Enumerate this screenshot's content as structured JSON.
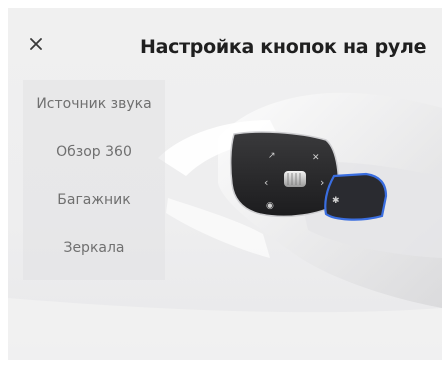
{
  "header": {
    "title": "Настройка кнопок на руле",
    "close_icon": "close-icon"
  },
  "menu": {
    "items": [
      {
        "label": "Источник звука"
      },
      {
        "label": "Обзор 360"
      },
      {
        "label": "Багажник"
      },
      {
        "label": "Зеркала"
      }
    ]
  },
  "wheel": {
    "highlight_color": "#3a6ee0"
  }
}
